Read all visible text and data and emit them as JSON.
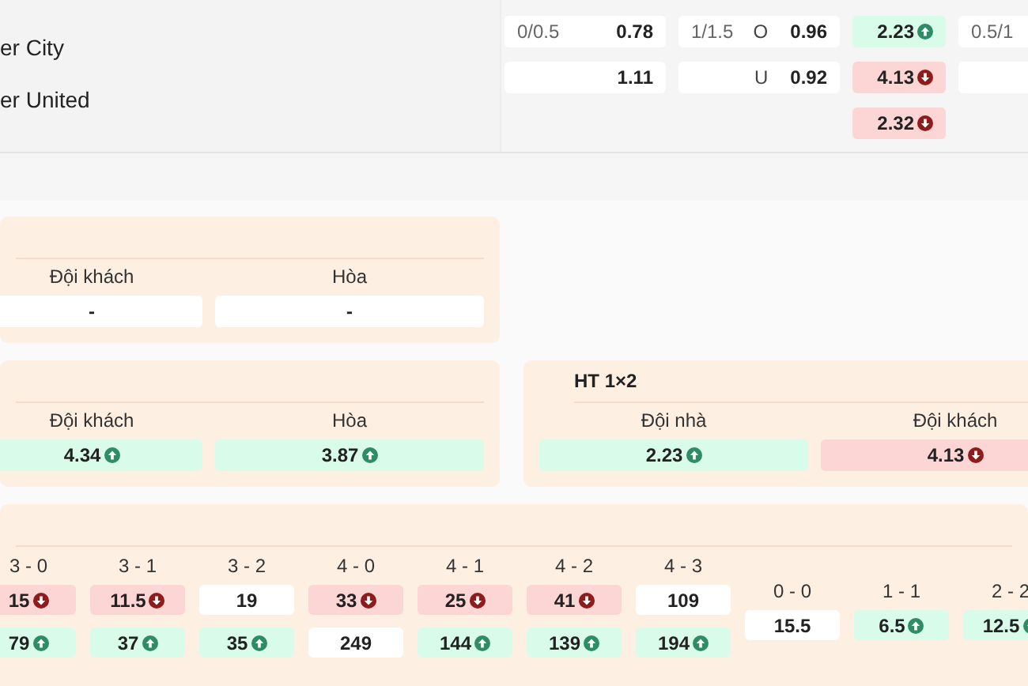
{
  "match": {
    "teams": [
      {
        "name": "er City"
      },
      {
        "name": "er United"
      }
    ]
  },
  "odds": [
    {
      "cells": [
        {
          "line": "0/0.5",
          "price": "0.78",
          "kind": "plain"
        },
        {
          "price": "1.11",
          "kind": "plain"
        }
      ]
    },
    {
      "cells": [
        {
          "line": "1/1.5",
          "side": "O",
          "price": "0.96",
          "kind": "plain"
        },
        {
          "side": "U",
          "price": "0.92",
          "kind": "plain"
        }
      ]
    },
    {
      "cells": [
        {
          "price": "2.23",
          "kind": "up"
        },
        {
          "price": "4.13",
          "kind": "down"
        },
        {
          "price": "2.32",
          "kind": "down"
        }
      ]
    },
    {
      "cells": [
        {
          "line": "0.5/1",
          "kind": "plain"
        },
        {
          "kind": "plain"
        }
      ]
    }
  ],
  "markets_left": [
    {
      "options": [
        {
          "label": "Đội khách",
          "price": "-",
          "kind": "plain"
        },
        {
          "label": "Hòa",
          "price": "-",
          "kind": "plain"
        }
      ]
    },
    {
      "options": [
        {
          "label": "Đội khách",
          "price": "4.34",
          "kind": "up"
        },
        {
          "label": "Hòa",
          "price": "3.87",
          "kind": "up"
        }
      ]
    }
  ],
  "markets_right": [
    {
      "title": "HT 1×2",
      "options": [
        {
          "label": "Đội nhà",
          "price": "2.23",
          "kind": "up"
        },
        {
          "label": "Đội khách",
          "price": "4.13",
          "kind": "down"
        }
      ]
    }
  ],
  "correct_score": {
    "groups": [
      {
        "columns": [
          {
            "score": "3 - 0",
            "prices": [
              {
                "price": "15",
                "kind": "down"
              },
              {
                "price": "79",
                "kind": "up"
              }
            ]
          },
          {
            "score": "3 - 1",
            "prices": [
              {
                "price": "11.5",
                "kind": "down"
              },
              {
                "price": "37",
                "kind": "up"
              }
            ]
          },
          {
            "score": "3 - 2",
            "prices": [
              {
                "price": "19",
                "kind": "plain"
              },
              {
                "price": "35",
                "kind": "up"
              }
            ]
          },
          {
            "score": "4 - 0",
            "prices": [
              {
                "price": "33",
                "kind": "down"
              },
              {
                "price": "249",
                "kind": "plain"
              }
            ]
          },
          {
            "score": "4 - 1",
            "prices": [
              {
                "price": "25",
                "kind": "down"
              },
              {
                "price": "144",
                "kind": "up"
              }
            ]
          },
          {
            "score": "4 - 2",
            "prices": [
              {
                "price": "41",
                "kind": "down"
              },
              {
                "price": "139",
                "kind": "up"
              }
            ]
          },
          {
            "score": "4 - 3",
            "prices": [
              {
                "price": "109",
                "kind": "plain"
              },
              {
                "price": "194",
                "kind": "up"
              }
            ]
          }
        ]
      },
      {
        "columns": [
          {
            "score": "0 - 0",
            "prices": [
              {
                "price": "15.5",
                "kind": "plain"
              }
            ]
          },
          {
            "score": "1 - 1",
            "prices": [
              {
                "price": "6.5",
                "kind": "up"
              }
            ]
          },
          {
            "score": "2 - 2",
            "prices": [
              {
                "price": "12.5",
                "kind": "up"
              }
            ]
          }
        ]
      }
    ]
  }
}
